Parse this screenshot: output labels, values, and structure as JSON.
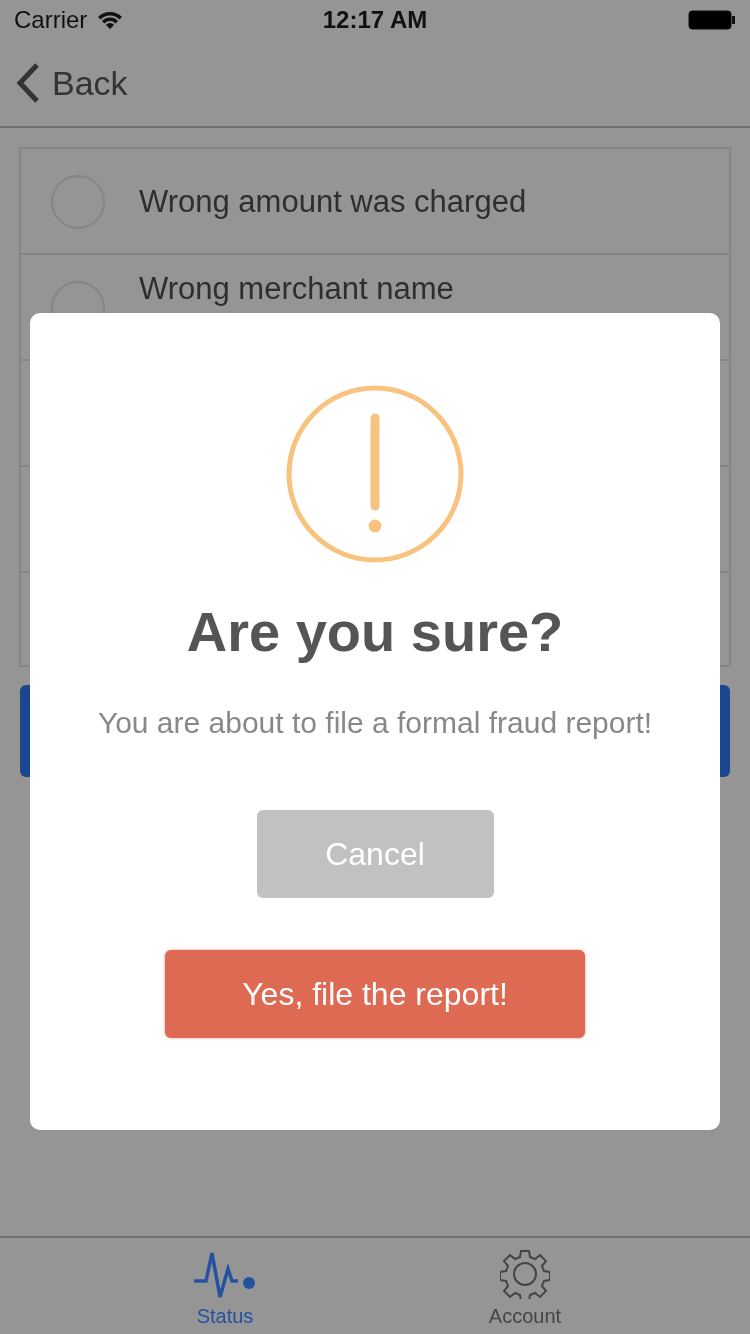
{
  "status_bar": {
    "carrier": "Carrier",
    "time": "12:17 AM"
  },
  "nav": {
    "back_label": "Back"
  },
  "options": [
    {
      "label": "Wrong amount was charged",
      "selected": false
    },
    {
      "label": "Wrong merchant name",
      "selected": false
    }
  ],
  "dialog": {
    "title": "Are you sure?",
    "message": "You are about to file a formal fraud report!",
    "buttons": [
      {
        "label": "Cancel",
        "kind": "cancel"
      },
      {
        "label": "Yes, file the report!",
        "kind": "confirm"
      }
    ]
  },
  "tabs": [
    {
      "label": "Status",
      "selected": true
    },
    {
      "label": "Account",
      "selected": false
    }
  ]
}
